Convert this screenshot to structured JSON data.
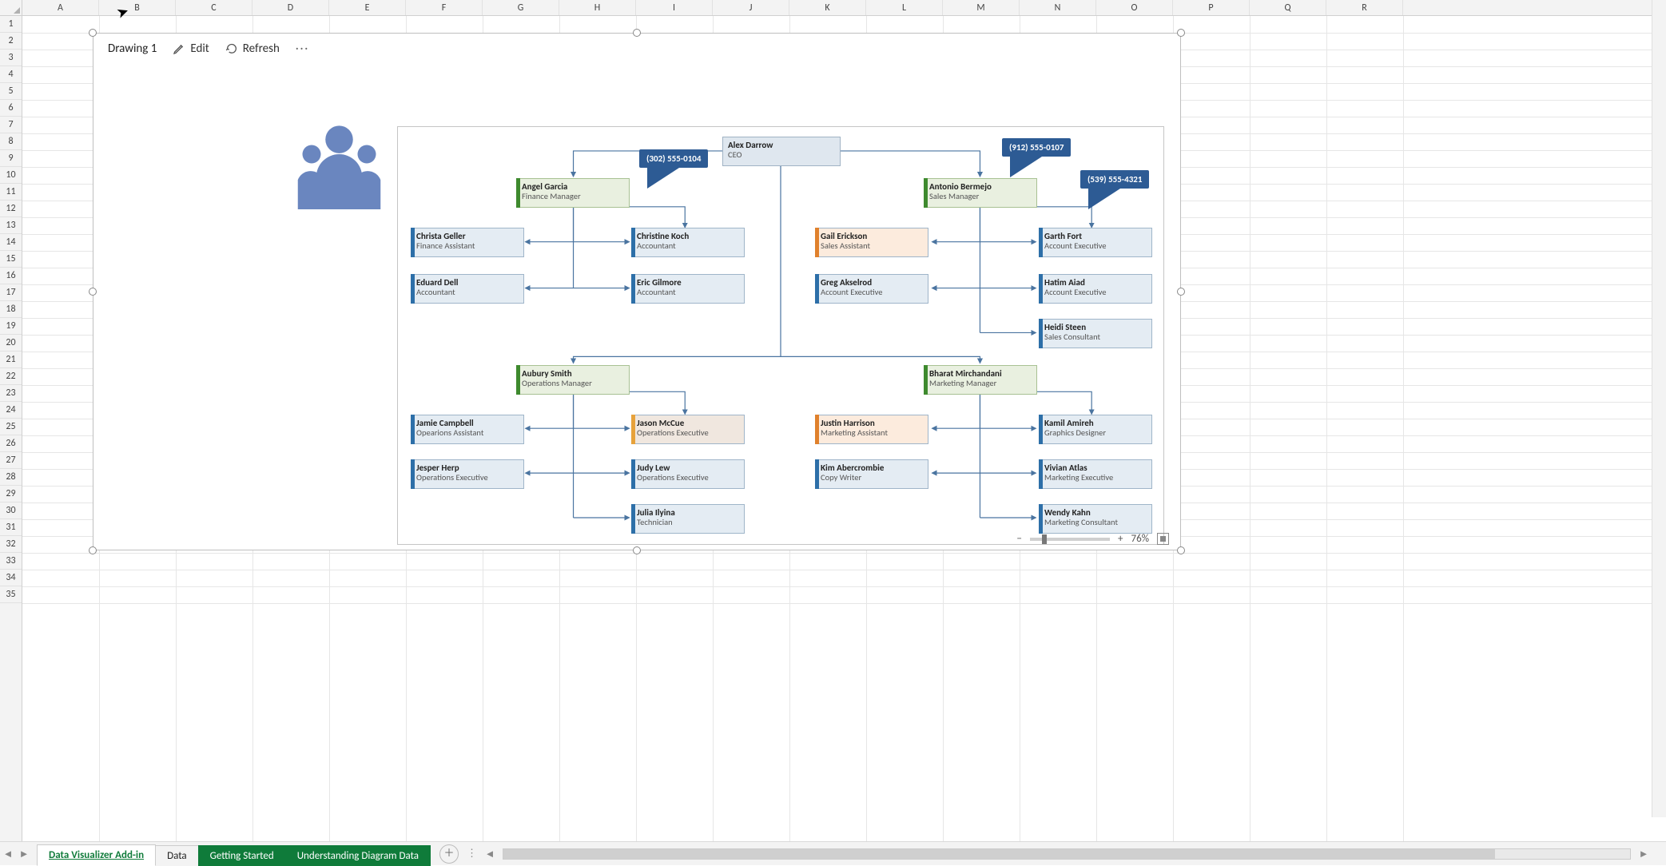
{
  "columns": [
    "A",
    "B",
    "C",
    "D",
    "E",
    "F",
    "G",
    "H",
    "I",
    "J",
    "K",
    "L",
    "M",
    "N",
    "O",
    "P",
    "Q",
    "R"
  ],
  "row_count": 35,
  "drawing": {
    "title": "Drawing 1",
    "edit_label": "Edit",
    "refresh_label": "Refresh",
    "zoom_value": "76%",
    "minus": "−",
    "plus": "+"
  },
  "tabs": {
    "items": [
      {
        "label": "Data Visualizer Add-in",
        "type": "active"
      },
      {
        "label": "Data",
        "type": "plain"
      },
      {
        "label": "Getting Started",
        "type": "green"
      },
      {
        "label": "Understanding Diagram Data",
        "type": "green"
      }
    ],
    "add_tooltip": "New sheet"
  },
  "callouts": {
    "c1": "(302) 555-0104",
    "c2": "(912) 555-0107",
    "c3": "(539) 555-4321"
  },
  "chart_data": {
    "type": "org-chart",
    "root": {
      "name": "Alex Darrow",
      "title": "CEO"
    },
    "managers": [
      {
        "name": "Angel Garcia",
        "title": "Finance Manager",
        "callout": "(302) 555-0104",
        "left": [
          {
            "name": "Christa Geller",
            "title": "Finance Assistant",
            "accent": "blue"
          },
          {
            "name": "Eduard Dell",
            "title": "Accountant",
            "accent": "blue"
          }
        ],
        "right": [
          {
            "name": "Christine Koch",
            "title": "Accountant",
            "accent": "blue"
          },
          {
            "name": "Eric Gilmore",
            "title": "Accountant",
            "accent": "blue"
          }
        ]
      },
      {
        "name": "Antonio Bermejo",
        "title": "Sales Manager",
        "callout": "(912) 555-0107",
        "left": [
          {
            "name": "Gail Erickson",
            "title": "Sales Assistant",
            "accent": "orange"
          },
          {
            "name": "Greg Akselrod",
            "title": "Account Executive",
            "accent": "blue"
          }
        ],
        "right": [
          {
            "name": "Garth Fort",
            "title": "Account Executive",
            "accent": "blue",
            "callout": "(539) 555-4321"
          },
          {
            "name": "Hatim Aiad",
            "title": "Account Executive",
            "accent": "blue"
          },
          {
            "name": "Heidi Steen",
            "title": "Sales Consultant",
            "accent": "blue"
          }
        ]
      },
      {
        "name": "Aubury Smith",
        "title": "Operations Manager",
        "left": [
          {
            "name": "Jamie Campbell",
            "title": "Opearions Assistant",
            "accent": "blue"
          },
          {
            "name": "Jesper Herp",
            "title": "Operations Executive",
            "accent": "blue"
          }
        ],
        "right": [
          {
            "name": "Jason McCue",
            "title": "Operations Executive",
            "accent": "gold"
          },
          {
            "name": "Judy Lew",
            "title": "Operations Executive",
            "accent": "blue"
          },
          {
            "name": "Julia Ilyina",
            "title": "Technician",
            "accent": "blue"
          }
        ]
      },
      {
        "name": "Bharat Mirchandani",
        "title": "Marketing Manager",
        "left": [
          {
            "name": "Justin Harrison",
            "title": "Marketing Assistant",
            "accent": "orange"
          },
          {
            "name": "Kim Abercrombie",
            "title": "Copy Writer",
            "accent": "blue"
          }
        ],
        "right": [
          {
            "name": "Kamil Amireh",
            "title": "Graphics Designer",
            "accent": "blue"
          },
          {
            "name": "Vivian Atlas",
            "title": "Marketing Executive",
            "accent": "blue"
          },
          {
            "name": "Wendy Kahn",
            "title": "Marketing Consultant",
            "accent": "blue"
          }
        ]
      }
    ]
  }
}
